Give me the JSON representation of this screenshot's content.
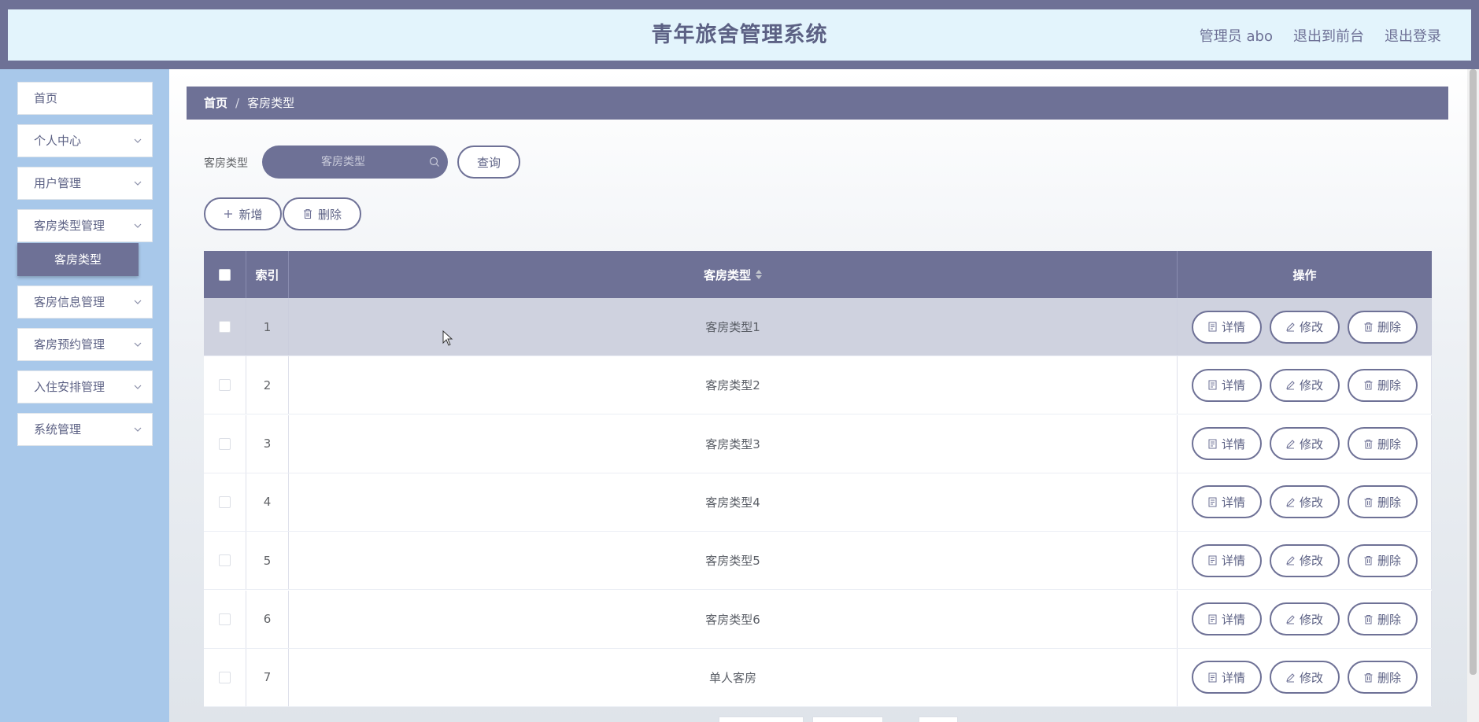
{
  "header": {
    "title": "青年旅舍管理系统",
    "user": "管理员 abo",
    "back_to_front": "退出到前台",
    "logout": "退出登录"
  },
  "sidebar": {
    "items": [
      {
        "label": "首页"
      },
      {
        "label": "个人中心"
      },
      {
        "label": "用户管理"
      },
      {
        "label": "客房类型管理"
      },
      {
        "label": "客房信息管理"
      },
      {
        "label": "客房预约管理"
      },
      {
        "label": "入住安排管理"
      },
      {
        "label": "系统管理"
      }
    ],
    "active_sub": "客房类型"
  },
  "breadcrumb": {
    "home": "首页",
    "separator": "/",
    "current": "客房类型"
  },
  "search": {
    "label": "客房类型",
    "placeholder": "客房类型",
    "query_button": "查询"
  },
  "actions": {
    "add": "新增",
    "delete": "删除"
  },
  "table": {
    "headers": {
      "index": "索引",
      "type": "客房类型",
      "operation": "操作"
    },
    "rows": [
      {
        "index": "1",
        "type": "客房类型1"
      },
      {
        "index": "2",
        "type": "客房类型2"
      },
      {
        "index": "3",
        "type": "客房类型3"
      },
      {
        "index": "4",
        "type": "客房类型4"
      },
      {
        "index": "5",
        "type": "客房类型5"
      },
      {
        "index": "6",
        "type": "客房类型6"
      },
      {
        "index": "7",
        "type": "单人客房"
      }
    ],
    "row_buttons": {
      "detail": "详情",
      "edit": "修改",
      "delete": "删除"
    }
  },
  "colors": {
    "primary": "#6e7196",
    "header_bg": "#e3f4fc",
    "sidebar_bg": "#a8c8ea",
    "row_hover": "#cfd2df"
  }
}
